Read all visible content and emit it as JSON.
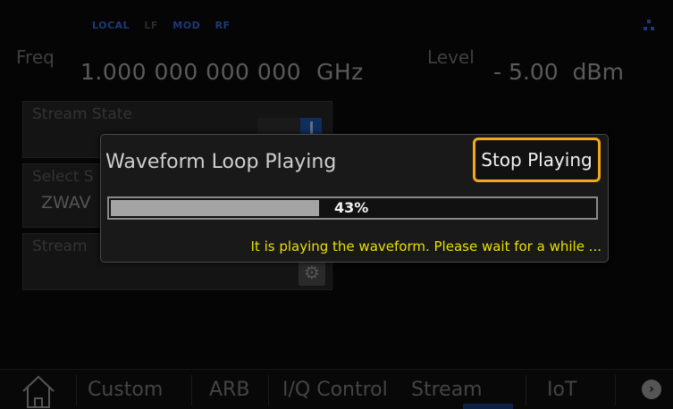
{
  "status_bar": {
    "local": "LOCAL",
    "lf": "LF",
    "mod": "MOD",
    "rf": "RF",
    "network_icon": "network-icon"
  },
  "frequency": {
    "label": "Freq",
    "value": "1.000 000 000 000",
    "unit": "GHz"
  },
  "level": {
    "label": "Level",
    "value": "- 5.00",
    "unit": "dBm"
  },
  "panels": {
    "stream_state": {
      "label": "Stream State"
    },
    "select_stream": {
      "label": "Select S",
      "value": "ZWAV"
    },
    "stream_settings": {
      "label": "Stream",
      "icon": "gear-icon"
    }
  },
  "nav": {
    "home_icon": "home-icon",
    "items": [
      "Custom",
      "ARB",
      "I/Q Control",
      "Stream",
      "IoT"
    ],
    "active": "Stream",
    "next_icon": "chevron-right-icon"
  },
  "dialog": {
    "title": "Waveform Loop Playing",
    "stop_label": "Stop Playing",
    "progress_percent": 43,
    "progress_text": "43%",
    "message": "It is playing the waveform. Please wait for a while ...",
    "accent_color": "#f0a81c",
    "message_color": "#e8e000"
  }
}
